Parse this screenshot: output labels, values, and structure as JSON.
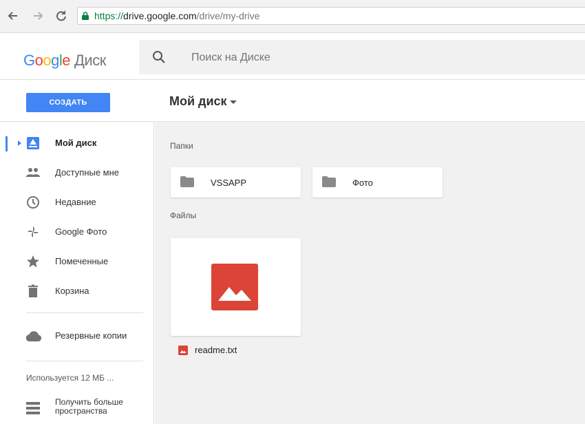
{
  "browser": {
    "back_icon": "arrow-left-icon",
    "forward_icon": "arrow-right-icon",
    "reload_icon": "reload-icon",
    "url_scheme": "https://",
    "url_host": "drive.google.com",
    "url_path": "/drive/my-drive"
  },
  "header": {
    "logo_letters": [
      "G",
      "o",
      "o",
      "g",
      "l",
      "e"
    ],
    "product_name": "Диск",
    "search_placeholder": "Поиск на Диске"
  },
  "toolbar": {
    "create_label": "СОЗДАТЬ",
    "title": "Мой диск"
  },
  "sidebar": {
    "items": [
      {
        "label": "Мой диск",
        "icon": "drive-icon",
        "active": true
      },
      {
        "label": "Доступные мне",
        "icon": "people-icon"
      },
      {
        "label": "Недавние",
        "icon": "clock-icon"
      },
      {
        "label": "Google Фото",
        "icon": "photos-pinwheel-icon"
      },
      {
        "label": "Помеченные",
        "icon": "star-icon"
      },
      {
        "label": "Корзина",
        "icon": "trash-icon"
      }
    ],
    "backup": {
      "label": "Резервные копии",
      "icon": "cloud-icon"
    },
    "storage_text": "Используется 12 МБ ...",
    "upgrade": {
      "label_line1": "Получить больше",
      "label_line2": "пространства",
      "icon": "storage-icon"
    }
  },
  "main": {
    "folders_title": "Папки",
    "folders": [
      {
        "name": "VSSAPP"
      },
      {
        "name": "Фото"
      }
    ],
    "files_title": "Файлы",
    "files": [
      {
        "name": "readme.txt",
        "icon": "image-file-icon"
      }
    ]
  },
  "colors": {
    "accent": "#4285f4",
    "file_icon_red": "#db4437",
    "icon_grey": "#737373"
  }
}
